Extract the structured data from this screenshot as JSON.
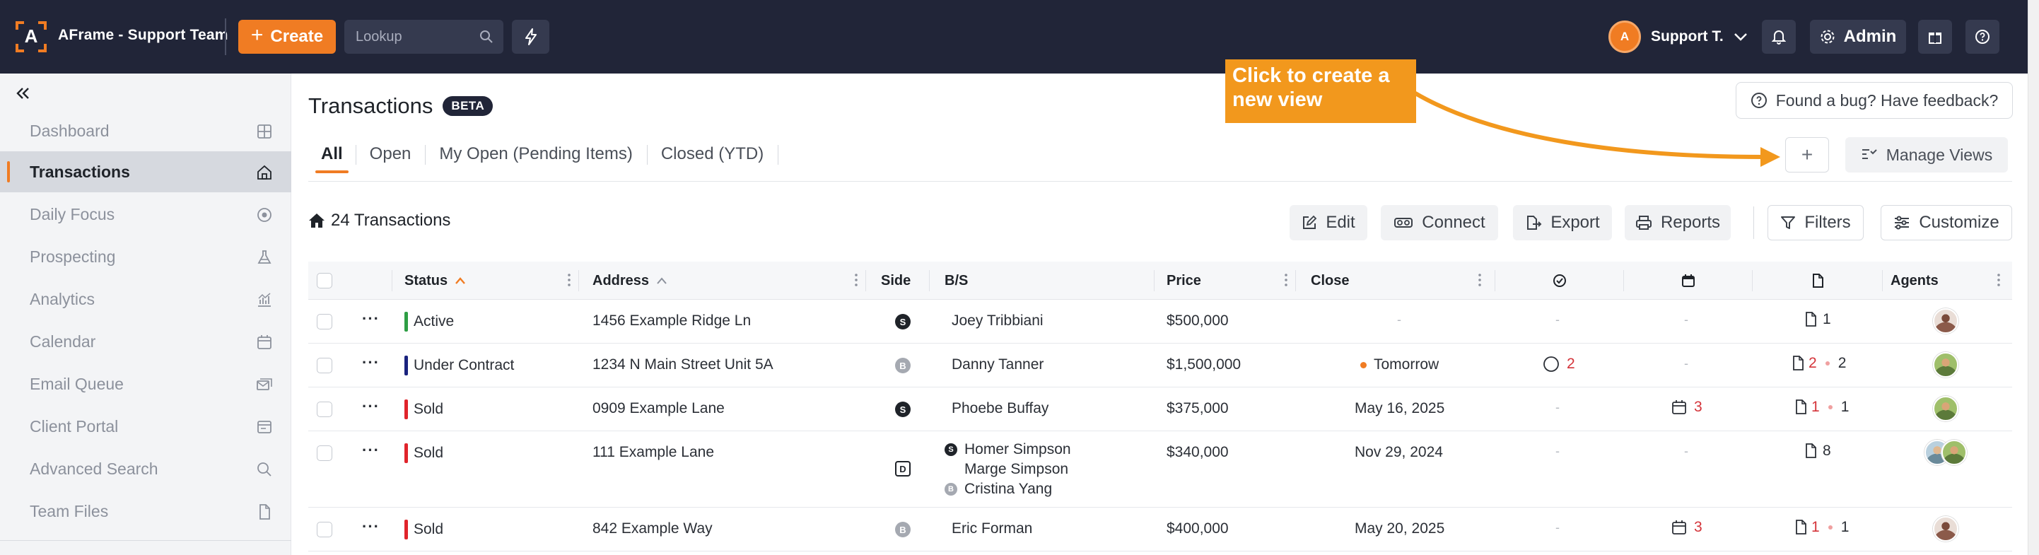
{
  "app": {
    "logo_letter": "A",
    "brand": "AFrame - Support Team",
    "create_label": "Create",
    "lookup_placeholder": "Lookup",
    "user_initial": "A",
    "user_name": "Support T.",
    "admin_label": "Admin",
    "accent_color": "#f07c23"
  },
  "sidebar": {
    "items": [
      {
        "label": "Dashboard",
        "icon": "grid-icon"
      },
      {
        "label": "Transactions",
        "icon": "home-icon",
        "active": true
      },
      {
        "label": "Daily Focus",
        "icon": "target-icon"
      },
      {
        "label": "Prospecting",
        "icon": "flask-icon"
      },
      {
        "label": "Analytics",
        "icon": "chart-icon"
      },
      {
        "label": "Calendar",
        "icon": "calendar-icon"
      },
      {
        "label": "Email Queue",
        "icon": "mail-queue-icon"
      },
      {
        "label": "Client Portal",
        "icon": "portal-icon"
      },
      {
        "label": "Advanced Search",
        "icon": "search-icon"
      },
      {
        "label": "Team Files",
        "icon": "file-icon"
      }
    ]
  },
  "main": {
    "title": "Transactions",
    "badge": "BETA",
    "feedback_label": "Found a bug? Have feedback?",
    "tabs": [
      "All",
      "Open",
      "My Open (Pending Items)",
      "Closed (YTD)"
    ],
    "add_view_symbol": "+",
    "manage_views_label": "Manage Views",
    "callout": "Click to create a new view",
    "count_label": "24 Transactions",
    "toolbar": {
      "edit": "Edit",
      "connect": "Connect",
      "export": "Export",
      "reports": "Reports",
      "filters": "Filters",
      "customize": "Customize"
    }
  },
  "table": {
    "headers": {
      "status": "Status",
      "address": "Address",
      "side": "Side",
      "bs": "B/S",
      "price": "Price",
      "close": "Close",
      "agents": "Agents"
    },
    "rows": [
      {
        "status": "Active",
        "status_color": "#2e9e44",
        "address": "1456 Example Ridge Ln",
        "side": "S",
        "people": [
          "Joey Tribbiani"
        ],
        "price": "$500,000",
        "close": "-",
        "check": "-",
        "cal": "-",
        "docs": "1",
        "docs_red": "",
        "agents": [
          "f"
        ]
      },
      {
        "status": "Under Contract",
        "status_color": "#1a237e",
        "address": "1234 N Main Street Unit 5A",
        "side": "B",
        "people": [
          "Danny Tanner"
        ],
        "price": "$1,500,000",
        "close": "Tomorrow",
        "close_dot": true,
        "check": "2",
        "cal": "-",
        "docs_red": "2",
        "docs": "2",
        "agents": [
          "m"
        ]
      },
      {
        "status": "Sold",
        "status_color": "#e0242b",
        "address": "0909 Example Lane",
        "side": "S",
        "people": [
          "Phoebe Buffay"
        ],
        "price": "$375,000",
        "close": "May 16, 2025",
        "check": "-",
        "cal": "3",
        "docs_red": "1",
        "docs": "1",
        "agents": [
          "m"
        ]
      },
      {
        "status": "Sold",
        "status_color": "#e0242b",
        "address": "111 Example Lane",
        "side": "D",
        "people": [
          "Homer Simpson",
          "Marge Simpson",
          "Cristina Yang"
        ],
        "people_sides": [
          "S",
          "",
          "B"
        ],
        "price": "$340,000",
        "close": "Nov 29, 2024",
        "check": "-",
        "cal": "-",
        "docs": "8",
        "docs_red": "",
        "agents": [
          "g",
          "m"
        ]
      },
      {
        "status": "Sold",
        "status_color": "#e0242b",
        "address": "842 Example Way",
        "side": "B",
        "people": [
          "Eric Forman"
        ],
        "price": "$400,000",
        "close": "May 20, 2025",
        "check": "-",
        "cal": "3",
        "docs_red": "1",
        "docs": "1",
        "agents": [
          "f"
        ]
      }
    ]
  }
}
